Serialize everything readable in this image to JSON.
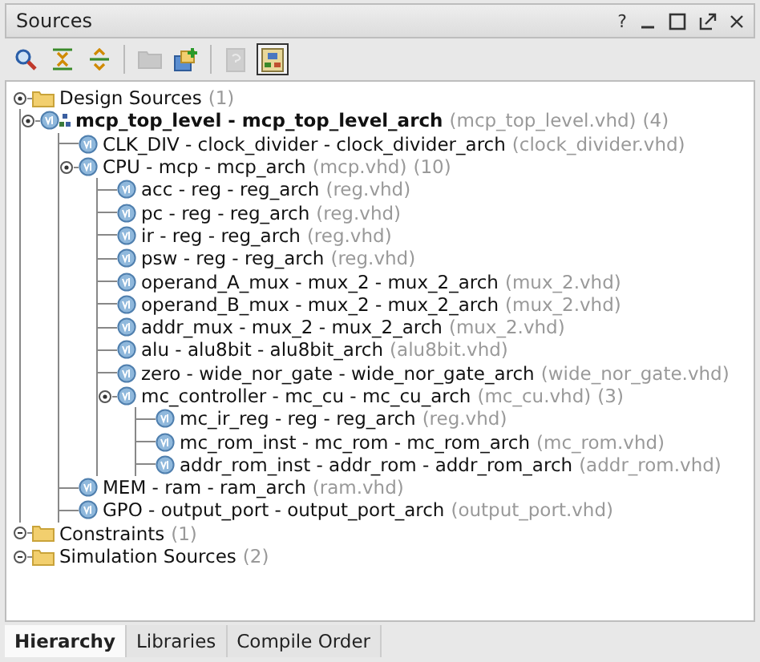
{
  "panel": {
    "title": "Sources",
    "help": "?"
  },
  "toolbar": [
    {
      "kind": "search",
      "disabled": false,
      "selected": false
    },
    {
      "kind": "collapse",
      "disabled": false,
      "selected": false
    },
    {
      "kind": "expand",
      "disabled": false,
      "selected": false
    },
    {
      "kind": "separator"
    },
    {
      "kind": "folder",
      "disabled": true,
      "selected": false
    },
    {
      "kind": "add",
      "disabled": false,
      "selected": false
    },
    {
      "kind": "separator"
    },
    {
      "kind": "document",
      "disabled": true,
      "selected": false
    },
    {
      "kind": "hierarchy",
      "disabled": false,
      "selected": true
    }
  ],
  "tree": [
    {
      "kind": "folder",
      "name": "Design Sources",
      "count": "(1)",
      "expanded": true,
      "children": [
        {
          "kind": "top",
          "name": "mcp_top_level - mcp_top_level_arch",
          "file": "(mcp_top_level.vhd)",
          "count": "(4)",
          "expanded": true,
          "children": [
            {
              "kind": "vhd",
              "name": "CLK_DIV - clock_divider - clock_divider_arch",
              "file": "(clock_divider.vhd)"
            },
            {
              "kind": "vhd",
              "name": "CPU - mcp - mcp_arch",
              "file": "(mcp.vhd)",
              "count": "(10)",
              "expanded": true,
              "children": [
                {
                  "kind": "vhd",
                  "name": "acc - reg - reg_arch",
                  "file": "(reg.vhd)"
                },
                {
                  "kind": "vhd",
                  "name": "pc - reg - reg_arch",
                  "file": "(reg.vhd)"
                },
                {
                  "kind": "vhd",
                  "name": "ir - reg - reg_arch",
                  "file": "(reg.vhd)"
                },
                {
                  "kind": "vhd",
                  "name": "psw - reg - reg_arch",
                  "file": "(reg.vhd)"
                },
                {
                  "kind": "vhd",
                  "name": "operand_A_mux - mux_2 - mux_2_arch",
                  "file": "(mux_2.vhd)"
                },
                {
                  "kind": "vhd",
                  "name": "operand_B_mux - mux_2 - mux_2_arch",
                  "file": "(mux_2.vhd)"
                },
                {
                  "kind": "vhd",
                  "name": "addr_mux - mux_2 - mux_2_arch",
                  "file": "(mux_2.vhd)"
                },
                {
                  "kind": "vhd",
                  "name": "alu - alu8bit - alu8bit_arch",
                  "file": "(alu8bit.vhd)"
                },
                {
                  "kind": "vhd",
                  "name": "zero - wide_nor_gate - wide_nor_gate_arch",
                  "file": "(wide_nor_gate.vhd)"
                },
                {
                  "kind": "vhd",
                  "name": "mc_controller - mc_cu - mc_cu_arch",
                  "file": "(mc_cu.vhd)",
                  "count": "(3)",
                  "expanded": true,
                  "children": [
                    {
                      "kind": "vhd",
                      "name": "mc_ir_reg - reg - reg_arch",
                      "file": "(reg.vhd)"
                    },
                    {
                      "kind": "vhd",
                      "name": "mc_rom_inst - mc_rom - mc_rom_arch",
                      "file": "(mc_rom.vhd)"
                    },
                    {
                      "kind": "vhd",
                      "name": "addr_rom_inst - addr_rom - addr_rom_arch",
                      "file": "(addr_rom.vhd)"
                    }
                  ]
                }
              ]
            },
            {
              "kind": "vhd",
              "name": "MEM - ram - ram_arch",
              "file": "(ram.vhd)"
            },
            {
              "kind": "vhd",
              "name": "GPO - output_port - output_port_arch",
              "file": "(output_port.vhd)"
            }
          ]
        }
      ]
    },
    {
      "kind": "folder",
      "name": "Constraints",
      "count": "(1)",
      "expanded": false
    },
    {
      "kind": "folder",
      "name": "Simulation Sources",
      "count": "(2)",
      "expanded": false
    }
  ],
  "tabs": [
    {
      "label": "Hierarchy",
      "selected": true
    },
    {
      "label": "Libraries",
      "selected": false
    },
    {
      "label": "Compile Order",
      "selected": false
    }
  ]
}
